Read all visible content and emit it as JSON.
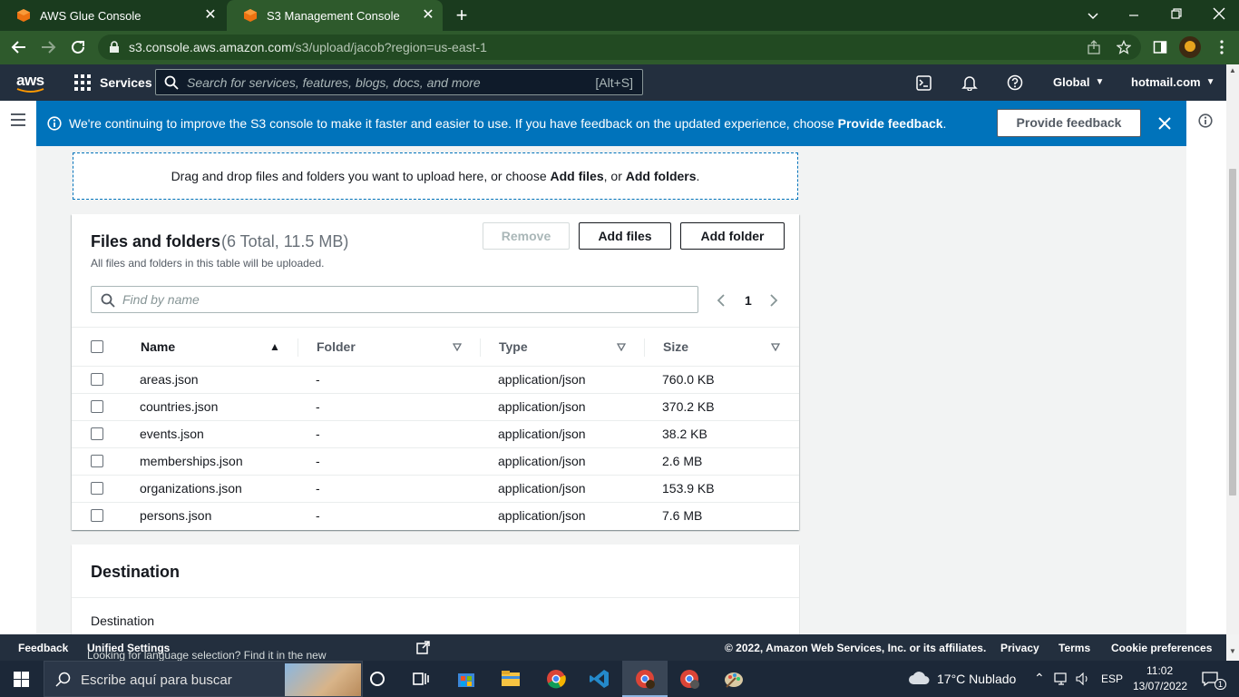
{
  "browser": {
    "tabs": [
      {
        "title": "AWS Glue Console",
        "active": false
      },
      {
        "title": "S3 Management Console",
        "active": true
      }
    ],
    "url_host": "s3.console.aws.amazon.com",
    "url_path": "/s3/upload/jacob?region=us-east-1"
  },
  "awsnav": {
    "logo": "aws",
    "services_label": "Services",
    "search_placeholder": "Search for services, features, blogs, docs, and more",
    "search_shortcut": "[Alt+S]",
    "region": "Global",
    "account": "hotmail.com"
  },
  "banner": {
    "message": "We're continuing to improve the S3 console to make it faster and easier to use. If you have feedback on the updated experience, choose ",
    "message_bold": "Provide feedback",
    "message_end": ".",
    "button_label": "Provide feedback",
    "color": "#0073bb"
  },
  "dropzone": {
    "text_start": "Drag and drop files and folders you want to upload here, or choose ",
    "add_files": "Add files",
    "text_mid": ", or ",
    "add_folders": "Add folders",
    "text_end": "."
  },
  "files_panel": {
    "title": "Files and folders",
    "count": "(6 Total, 11.5 MB)",
    "description": "All files and folders in this table will be uploaded.",
    "remove_label": "Remove",
    "add_files_label": "Add files",
    "add_folder_label": "Add folder",
    "find_placeholder": "Find by name",
    "page": "1",
    "columns": [
      "Name",
      "Folder",
      "Type",
      "Size"
    ],
    "rows": [
      {
        "name": "areas.json",
        "folder": "-",
        "type": "application/json",
        "size": "760.0 KB"
      },
      {
        "name": "countries.json",
        "folder": "-",
        "type": "application/json",
        "size": "370.2 KB"
      },
      {
        "name": "events.json",
        "folder": "-",
        "type": "application/json",
        "size": "38.2 KB"
      },
      {
        "name": "memberships.json",
        "folder": "-",
        "type": "application/json",
        "size": "2.6 MB"
      },
      {
        "name": "organizations.json",
        "folder": "-",
        "type": "application/json",
        "size": "153.9 KB"
      },
      {
        "name": "persons.json",
        "folder": "-",
        "type": "application/json",
        "size": "7.6 MB"
      }
    ]
  },
  "destination": {
    "title": "Destination",
    "label": "Destination"
  },
  "footer": {
    "feedback": "Feedback",
    "language_text": "Looking for language selection? Find it in the new ",
    "unified_settings": "Unified Settings",
    "copyright": "© 2022, Amazon Web Services, Inc. or its affiliates.",
    "privacy": "Privacy",
    "terms": "Terms",
    "cookie": "Cookie preferences"
  },
  "taskbar": {
    "search_placeholder": "Escribe aquí para buscar",
    "weather": "17°C  Nublado",
    "language": "ESP",
    "time": "11:02",
    "date": "13/07/2022",
    "notifications": "1"
  }
}
